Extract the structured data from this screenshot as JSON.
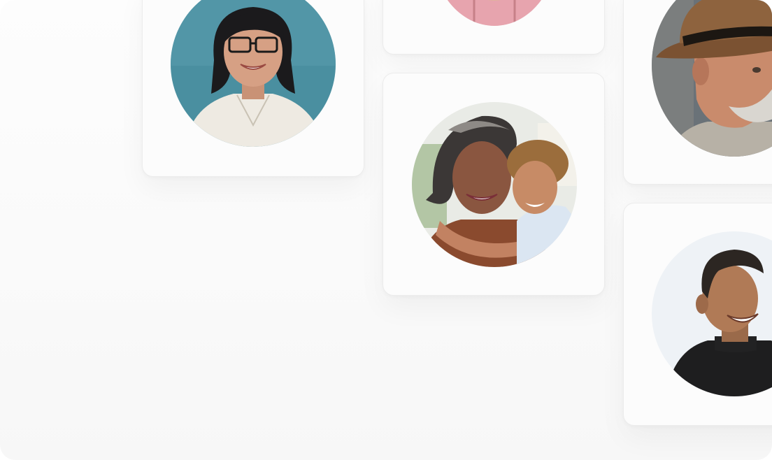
{
  "gallery": {
    "cards": [
      {
        "id": "woman-glasses",
        "photo": "portrait-woman-glasses"
      },
      {
        "id": "top-partial",
        "photo": "portrait-pink-top"
      },
      {
        "id": "man-hat",
        "photo": "portrait-man-straw-hat"
      },
      {
        "id": "grandmother-child",
        "photo": "portrait-grandmother-and-child"
      },
      {
        "id": "smiling-man",
        "photo": "portrait-smiling-man-wetsuit"
      }
    ]
  },
  "colors": {
    "background": "#fafafa",
    "card": "#fcfcfc",
    "card_border": "#ececec"
  }
}
